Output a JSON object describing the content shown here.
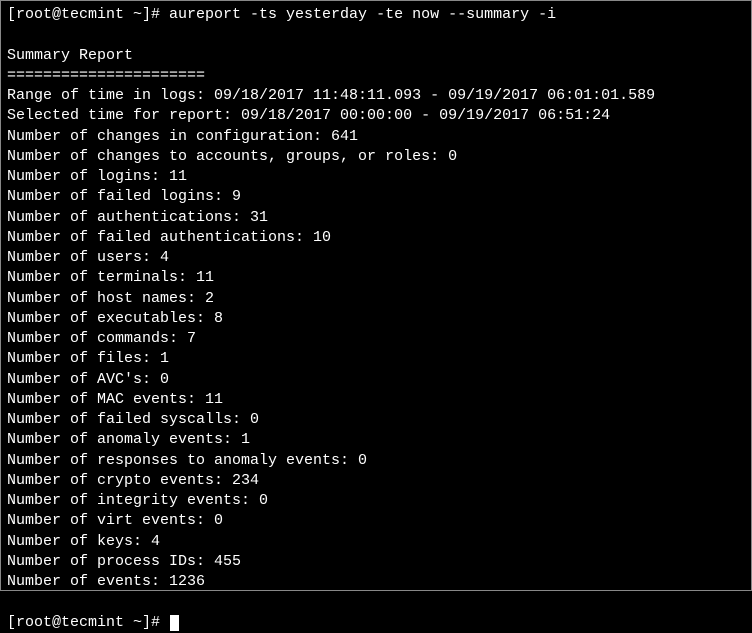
{
  "prompt1": "[root@tecmint ~]# ",
  "command": "aureport -ts yesterday -te now --summary -i",
  "title": "Summary Report",
  "divider": "======================",
  "rows": [
    "Range of time in logs: 09/18/2017 11:48:11.093 - 09/19/2017 06:01:01.589",
    "Selected time for report: 09/18/2017 00:00:00 - 09/19/2017 06:51:24",
    "Number of changes in configuration: 641",
    "Number of changes to accounts, groups, or roles: 0",
    "Number of logins: 11",
    "Number of failed logins: 9",
    "Number of authentications: 31",
    "Number of failed authentications: 10",
    "Number of users: 4",
    "Number of terminals: 11",
    "Number of host names: 2",
    "Number of executables: 8",
    "Number of commands: 7",
    "Number of files: 1",
    "Number of AVC's: 0",
    "Number of MAC events: 11",
    "Number of failed syscalls: 0",
    "Number of anomaly events: 1",
    "Number of responses to anomaly events: 0",
    "Number of crypto events: 234",
    "Number of integrity events: 0",
    "Number of virt events: 0",
    "Number of keys: 4",
    "Number of process IDs: 455",
    "Number of events: 1236"
  ],
  "prompt2": "[root@tecmint ~]# "
}
